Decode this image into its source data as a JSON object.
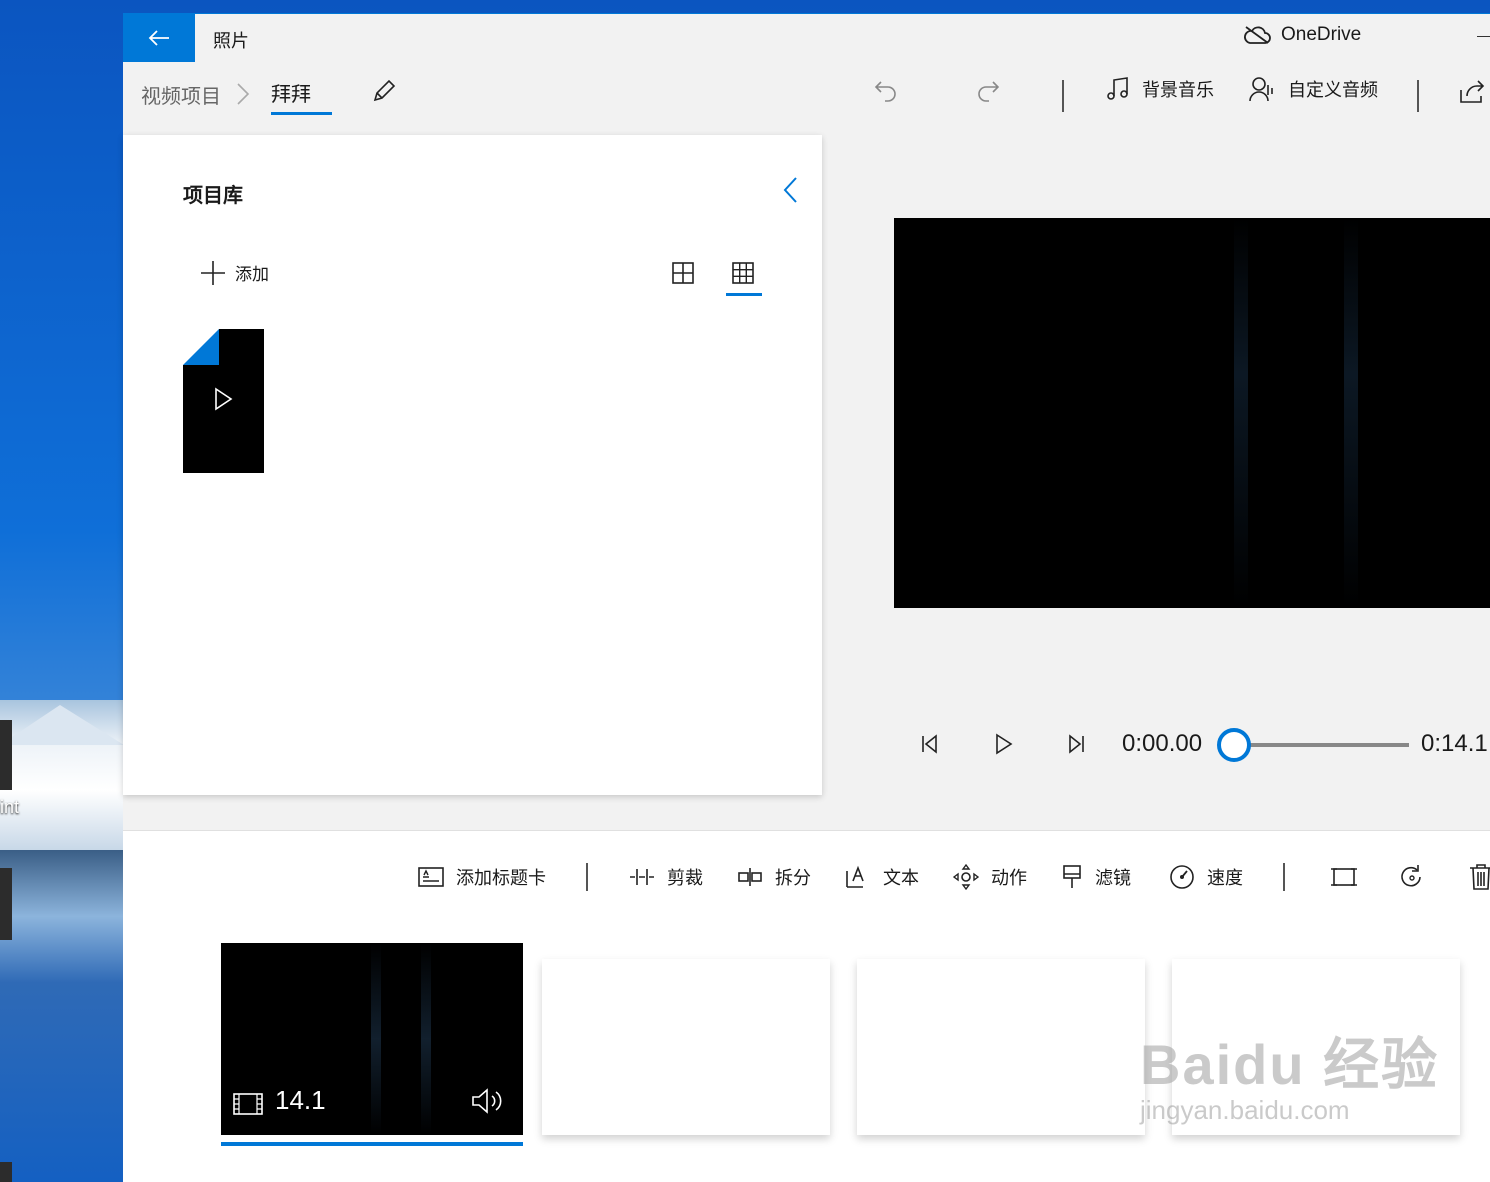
{
  "desktop": {
    "icon_label": "int"
  },
  "app": {
    "title": "照片",
    "onedrive_label": "OneDrive"
  },
  "breadcrumb": {
    "root": "视频项目",
    "current": "拜拜"
  },
  "toolbar": {
    "music_label": "背景音乐",
    "custom_audio_label": "自定义音频"
  },
  "library": {
    "title": "项目库",
    "add_label": "添加"
  },
  "player": {
    "current_time": "0:00.00",
    "total_time": "0:14.1",
    "progress": 0
  },
  "storyboard": {
    "tools": [
      {
        "label": "添加标题卡"
      },
      {
        "label": "剪裁"
      },
      {
        "label": "拆分"
      },
      {
        "label": "文本"
      },
      {
        "label": "动作"
      },
      {
        "label": "滤镜"
      },
      {
        "label": "速度"
      }
    ],
    "clips": [
      {
        "duration": "14.1"
      }
    ]
  },
  "watermark": {
    "logo": "Baidu 经验",
    "url": "jingyan.baidu.com"
  },
  "colors": {
    "accent": "#0078d7",
    "window_bg": "#f2f2f2",
    "panel_bg": "#ffffff"
  }
}
